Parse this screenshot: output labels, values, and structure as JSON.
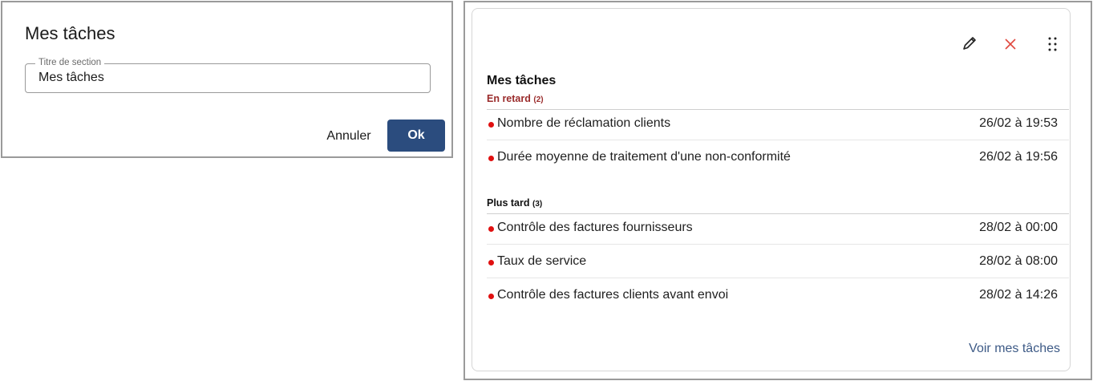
{
  "dialog": {
    "title": "Mes tâches",
    "field_label": "Titre de section",
    "field_value": "Mes tâches",
    "cancel_label": "Annuler",
    "ok_label": "Ok"
  },
  "widget": {
    "title": "Mes tâches",
    "icons": [
      "pencil-icon",
      "close-icon",
      "drag-handle-icon"
    ],
    "sections": [
      {
        "label": "En retard",
        "count": "(2)",
        "color": "#9a2b2b",
        "tasks": [
          {
            "name": "Nombre de réclamation clients",
            "date": "26/02 à 19:53"
          },
          {
            "name": "Durée moyenne de traitement d'une non-conformité",
            "date": "26/02 à 19:56"
          }
        ]
      },
      {
        "label": "Plus tard",
        "count": "(3)",
        "color": "#111111",
        "tasks": [
          {
            "name": "Contrôle des factures fournisseurs",
            "date": "28/02 à 00:00"
          },
          {
            "name": "Taux de service",
            "date": "28/02 à 08:00"
          },
          {
            "name": "Contrôle des factures clients avant envoi",
            "date": "28/02 à 14:26"
          }
        ]
      }
    ],
    "footer_link": "Voir mes tâches",
    "accent_color": "#2b4c7e",
    "status_dot_color": "#e01010"
  }
}
